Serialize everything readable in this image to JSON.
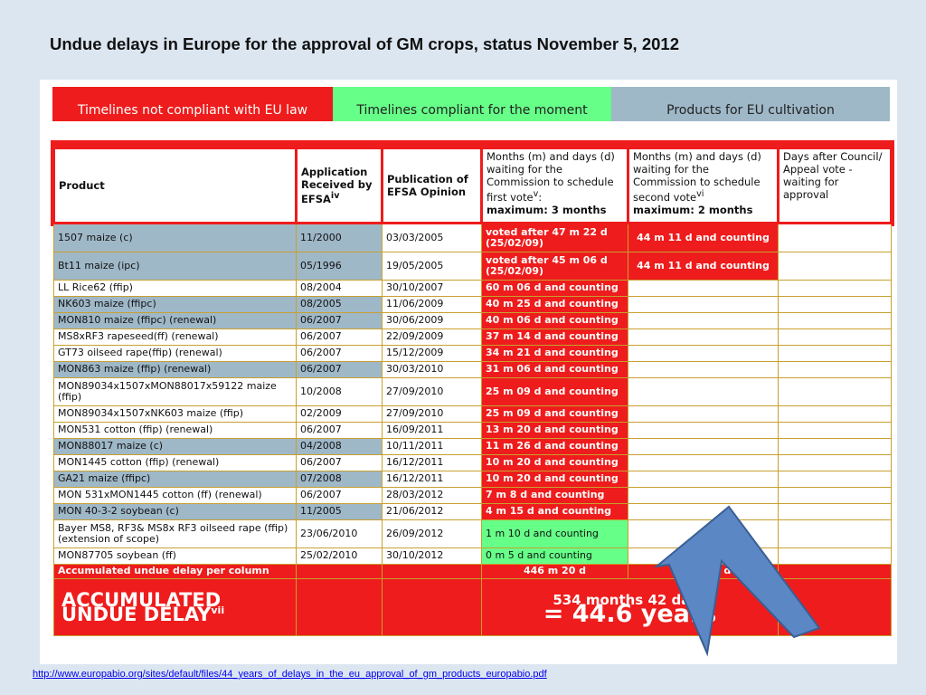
{
  "title": "Undue delays in Europe for the approval of GM crops, status November 5, 2012",
  "legend": {
    "red": "Timelines not compliant with EU law",
    "green": "Timelines compliant for the moment",
    "grey": "Products for EU cultivation"
  },
  "headers": {
    "product": "Product",
    "application": "Application Received by EFSA",
    "application_sup": "iv",
    "publication": "Publication of EFSA Opinion",
    "first_vote": "Months (m) and days (d) waiting for the Commission to schedule first vote",
    "first_vote_sup": "v",
    "first_vote_max": "maximum: 3 months",
    "second_vote": "Months (m) and days (d) waiting for the Commission to schedule second vote",
    "second_vote_sup": "vi",
    "second_vote_max": "maximum: 2 months",
    "council": "Days after Council/ Appeal vote - waiting for approval"
  },
  "rows": [
    {
      "product": "1507 maize (c)",
      "app": "11/2000",
      "pub": "03/03/2005",
      "first": "voted after 47 m 22 d (25/02/09)",
      "second": "44 m 11 d and counting",
      "council": ""
    },
    {
      "product": "Bt11 maize (ipc)",
      "app": "05/1996",
      "pub": "19/05/2005",
      "first": "voted after 45 m 06 d (25/02/09)",
      "second": "44 m 11 d and counting",
      "council": ""
    },
    {
      "product": "LL Rice62 (ffip)",
      "app": "08/2004",
      "pub": "30/10/2007",
      "first": "60 m 06 d and counting",
      "second": "",
      "council": ""
    },
    {
      "product": "NK603 maize (ffipc)",
      "app": "08/2005",
      "pub": "11/06/2009",
      "first": "40 m 25 d and counting",
      "second": "",
      "council": ""
    },
    {
      "product": "MON810 maize (ffipc) (renewal)",
      "app": "06/2007",
      "pub": "30/06/2009",
      "first": "40 m 06 d and counting",
      "second": "",
      "council": ""
    },
    {
      "product": "MS8xRF3 rapeseed(ff) (renewal)",
      "app": "06/2007",
      "pub": "22/09/2009",
      "first": "37 m 14 d and counting",
      "second": "",
      "council": ""
    },
    {
      "product": "GT73 oilseed rape(ffip) (renewal)",
      "app": "06/2007",
      "pub": "15/12/2009",
      "first": "34 m 21 d and counting",
      "second": "",
      "council": ""
    },
    {
      "product": "MON863 maize (ffip) (renewal)",
      "app": "06/2007",
      "pub": "30/03/2010",
      "first": "31 m 06 d and counting",
      "second": "",
      "council": ""
    },
    {
      "product": "MON89034x1507xMON88017x59122 maize (ffip)",
      "app": "10/2008",
      "pub": "27/09/2010",
      "first": "25 m 09 d and counting",
      "second": "",
      "council": ""
    },
    {
      "product": "MON89034x1507xNK603 maize (ffip)",
      "app": "02/2009",
      "pub": "27/09/2010",
      "first": "25 m 09 d and counting",
      "second": "",
      "council": ""
    },
    {
      "product": "MON531 cotton (ffip) (renewal)",
      "app": "06/2007",
      "pub": "16/09/2011",
      "first": "13 m 20 d and counting",
      "second": "",
      "council": ""
    },
    {
      "product": "MON88017 maize (c)",
      "app": "04/2008",
      "pub": "10/11/2011",
      "first": "11 m 26 d and counting",
      "second": "",
      "council": ""
    },
    {
      "product": "MON1445 cotton (ffip) (renewal)",
      "app": "06/2007",
      "pub": "16/12/2011",
      "first": "10 m 20 d and counting",
      "second": "",
      "council": ""
    },
    {
      "product": "GA21 maize (ffipc)",
      "app": "07/2008",
      "pub": "16/12/2011",
      "first": "10 m 20 d and counting",
      "second": "",
      "council": ""
    },
    {
      "product": "MON 531xMON1445 cotton (ff) (renewal)",
      "app": "06/2007",
      "pub": "28/03/2012",
      "first": "7 m 8 d and counting",
      "second": "",
      "council": ""
    },
    {
      "product": "MON 40-3-2 soybean (c)",
      "app": "11/2005",
      "pub": "21/06/2012",
      "first": "4 m 15 d and counting",
      "second": "",
      "council": ""
    },
    {
      "product": "Bayer MS8, RF3& MS8x RF3 oilseed rape (ffip) (extension of scope)",
      "app": "23/06/2010",
      "pub": "26/09/2012",
      "first": "1 m 10 d and counting",
      "second": "",
      "council": ""
    },
    {
      "product": "MON87705 soybean (ff)",
      "app": "25/02/2010",
      "pub": "30/10/2012",
      "first": "0 m 5 d and counting",
      "second": "",
      "council": ""
    }
  ],
  "accumulated_row": {
    "label": "Accumulated undue delay per column",
    "first": "446 m 20 d",
    "second": "88 m 22 d"
  },
  "total": {
    "label_line1": "ACCUMULATED",
    "label_line2": "UNDUE DELAY",
    "label_sup": "vii",
    "months": "534 months 42 days",
    "years": "= 44.6 years"
  },
  "source_url": "http://www.europabio.org/sites/default/files/44_years_of_delays_in_the_eu_approval_of_gm_products_europabio.pdf",
  "colors": {
    "not_compliant": "#ee1c1c",
    "compliant": "#66ff88",
    "cultivation": "#9fb8c8",
    "arrow": "#5b87c4"
  }
}
